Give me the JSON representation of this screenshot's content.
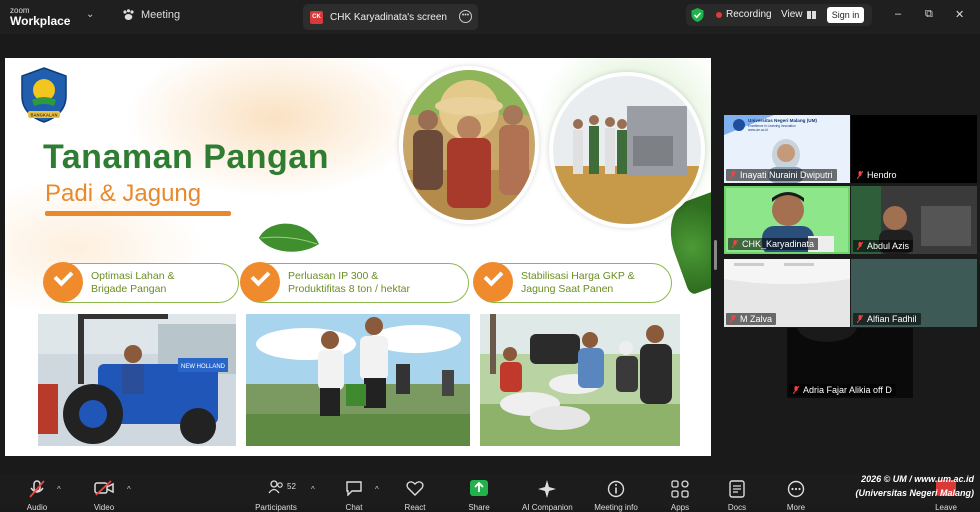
{
  "app": {
    "brand_top": "zoom",
    "brand_bottom": "Workplace",
    "meeting_label": "Meeting"
  },
  "share_tab": {
    "badge": "CK",
    "title": "CHK Karyadinata's screen"
  },
  "header_right": {
    "recording": "Recording",
    "view": "View",
    "signin": "Sign in"
  },
  "window": {
    "minimize": "–",
    "restore": "⧉",
    "close": "✕"
  },
  "slide": {
    "logo_text": "BANGKALAN",
    "title": "Tanaman Pangan",
    "subtitle": "Padi & Jagung",
    "pills": [
      {
        "line1": "Optimasi Lahan &",
        "line2": "Brigade Pangan"
      },
      {
        "line1": "Perluasan IP 300 &",
        "line2": "Produktifitas 8 ton / hektar"
      },
      {
        "line1": "Stabilisasi Harga GKP &",
        "line2": "Jagung Saat Panen"
      }
    ],
    "tractor_text": "NEW HOLLAND"
  },
  "first_tile": {
    "org": "Universitas Negeri Malang (UM)",
    "tagline": "Excellence in Learning Innovation",
    "url": "www.um.ac.id"
  },
  "participants": [
    {
      "name": "Inayati Nuraini Dwiputri"
    },
    {
      "name": "Hendro"
    },
    {
      "name": "CHK_Karyadinata"
    },
    {
      "name": "Abdul Azis"
    },
    {
      "name": "M Zalva"
    },
    {
      "name": "Alfian Fadhil"
    },
    {
      "name": "Adria Fajar Alikia off D"
    }
  ],
  "toolbar": {
    "audio": "Audio",
    "video": "Video",
    "participants": "Participants",
    "participants_count": "52",
    "chat": "Chat",
    "react": "React",
    "share": "Share",
    "ai": "AI Companion",
    "info": "Meeting info",
    "apps": "Apps",
    "docs": "Docs",
    "more": "More",
    "leave": "Leave"
  },
  "watermark": {
    "line1": "2026 © UM / www.um.ac.id",
    "line2": "(Universitas Negeri Malang)"
  },
  "colors": {
    "title_green": "#2e7d32",
    "accent_orange": "#ef8b2c",
    "pill_border": "#8db84c",
    "share_green": "#22b14c"
  }
}
